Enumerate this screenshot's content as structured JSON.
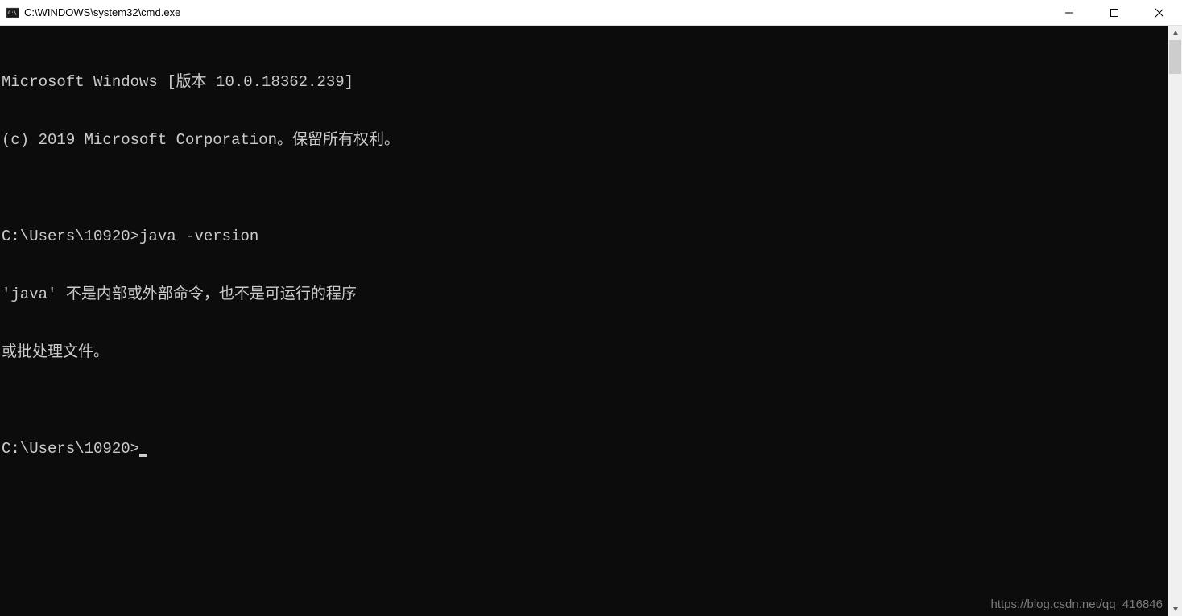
{
  "window": {
    "title": "C:\\WINDOWS\\system32\\cmd.exe"
  },
  "terminal": {
    "lines": [
      "Microsoft Windows [版本 10.0.18362.239]",
      "(c) 2019 Microsoft Corporation。保留所有权利。",
      "",
      "C:\\Users\\10920>java -version",
      "'java' 不是内部或外部命令，也不是可运行的程序",
      "或批处理文件。",
      "",
      "C:\\Users\\10920>"
    ]
  },
  "watermark": "https://blog.csdn.net/qq_416846"
}
